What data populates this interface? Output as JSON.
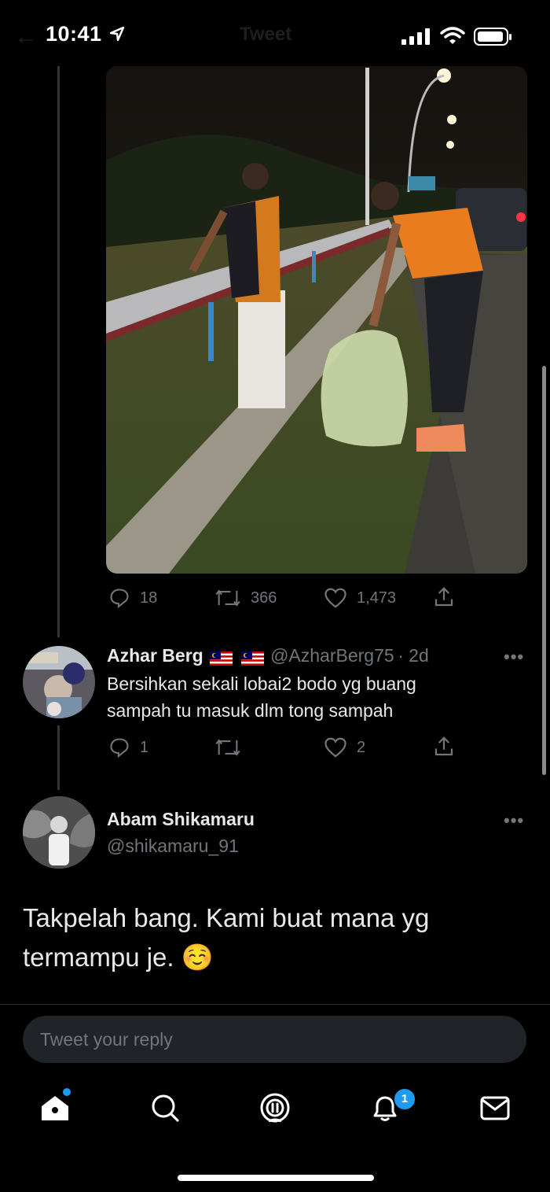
{
  "status_bar": {
    "time": "10:41",
    "title": "Tweet"
  },
  "main_tweet": {
    "reply_count": "18",
    "retweet_count": "366",
    "like_count": "1,473"
  },
  "reply_1": {
    "name": "Azhar Berg",
    "handle": "@AzharBerg75",
    "time": "· 2d",
    "text_line1": "Bersihkan sekali lobai2 bodo yg buang",
    "text_line2": "sampah tu masuk dlm tong sampah",
    "reply_count": "1",
    "like_count": "2"
  },
  "focused_tweet": {
    "name": "Abam Shikamaru",
    "handle": "@shikamaru_91",
    "text_line1": "Takpelah bang. Kami buat mana yg",
    "text_line2": "termampu je.",
    "emoji": "☺️"
  },
  "reply_box": {
    "placeholder": "Tweet your reply"
  },
  "tab_bar": {
    "notification_badge": "1"
  },
  "colors": {
    "accent": "#1d9bf0",
    "background": "#000000",
    "muted": "#71767b"
  }
}
